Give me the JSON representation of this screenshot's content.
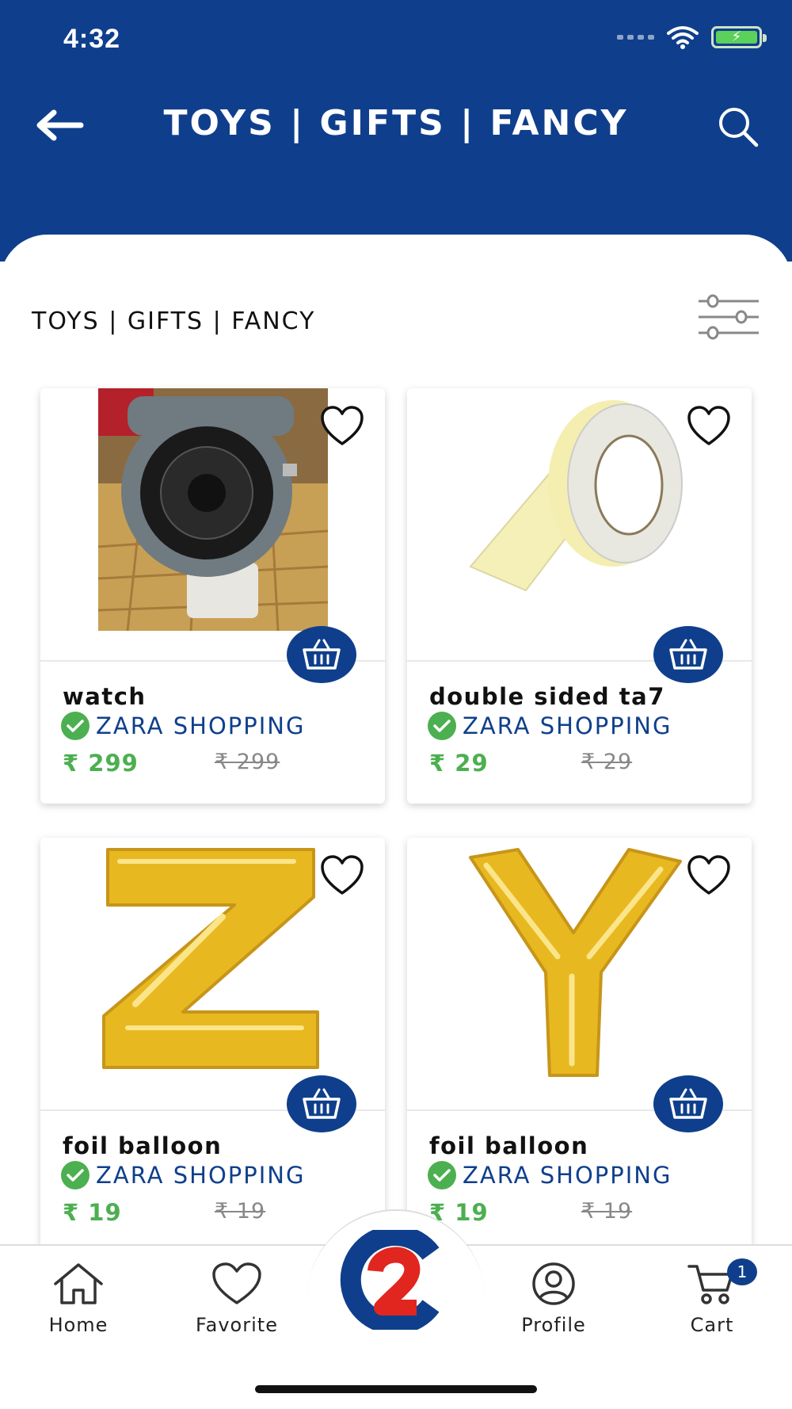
{
  "status_bar": {
    "time": "4:32"
  },
  "header": {
    "title": "TOYS | GIFTS | FANCY"
  },
  "section": {
    "title": "TOYS | GIFTS | FANCY"
  },
  "products": [
    {
      "name": "watch",
      "shop": "ZARA SHOPPING",
      "price": "₹ 299",
      "old_price": "₹ 299"
    },
    {
      "name": "double sided ta7",
      "shop": "ZARA SHOPPING",
      "price": "₹ 29",
      "old_price": "₹ 29"
    },
    {
      "name": "foil balloon",
      "shop": "ZARA SHOPPING",
      "price": "₹ 19",
      "old_price": "₹ 19"
    },
    {
      "name": "foil balloon",
      "shop": "ZARA SHOPPING",
      "price": "₹ 19",
      "old_price": "₹ 19"
    }
  ],
  "bottom_nav": {
    "home": "Home",
    "favorite": "Favorite",
    "profile": "Profile",
    "cart": "Cart",
    "cart_count": "1"
  },
  "colors": {
    "brand": "#0f3f8c",
    "price": "#4caf50",
    "logo_red": "#e0261f"
  }
}
